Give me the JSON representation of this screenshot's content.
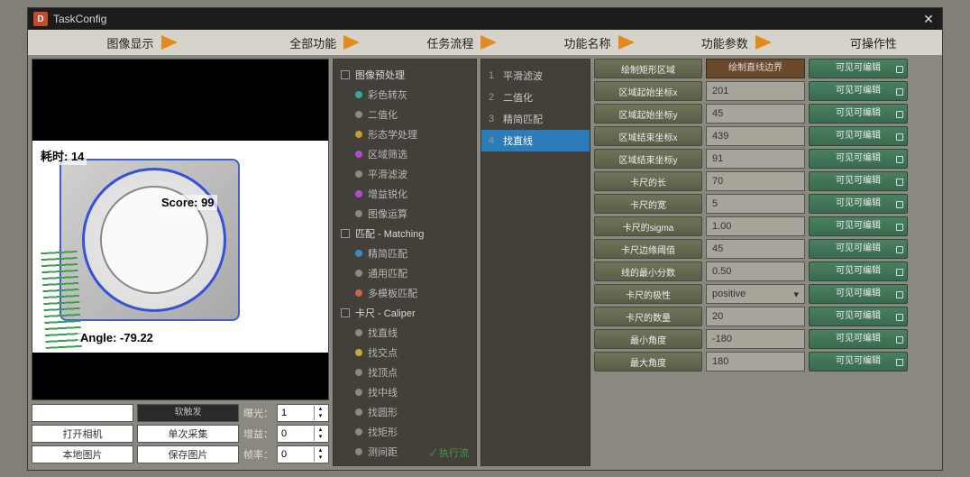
{
  "window": {
    "title": "TaskConfig"
  },
  "headers": [
    "图像显示",
    "全部功能",
    "任务流程",
    "功能名称",
    "功能参数",
    "可操作性"
  ],
  "image": {
    "timing": "耗时: 14",
    "score": "Score: 99",
    "angle": "Angle: -79.22"
  },
  "imgctrl": {
    "row1": {
      "darklabel": "软触发",
      "label": "曝光：",
      "value": "1"
    },
    "row2": {
      "btn1": "打开相机",
      "btn2": "单次采集",
      "label": "增益：",
      "value": "0"
    },
    "row3": {
      "btn1": "本地图片",
      "btn2": "保存图片",
      "label": "帧率：",
      "value": "0"
    }
  },
  "funcs": {
    "cat1": "图像预处理",
    "items1": [
      {
        "label": "彩色转灰",
        "color": "#39a5a5"
      },
      {
        "label": "二值化",
        "color": "#888"
      },
      {
        "label": "形态学处理",
        "color": "#c79a3a"
      },
      {
        "label": "区域筛选",
        "color": "#b44ad0"
      },
      {
        "label": "平滑滤波",
        "color": "#888"
      },
      {
        "label": "增益锐化",
        "color": "#b44ad0"
      },
      {
        "label": "图像运算",
        "color": "#888"
      }
    ],
    "cat2": "匹配 - Matching",
    "items2": [
      {
        "label": "精简匹配",
        "color": "#3a8ac8"
      },
      {
        "label": "通用匹配",
        "color": "#888"
      },
      {
        "label": "多模板匹配",
        "color": "#c46a4a"
      }
    ],
    "cat3": "卡尺 - Caliper",
    "items3": [
      {
        "label": "找直线",
        "color": "#888"
      },
      {
        "label": "找交点",
        "color": "#c8a838"
      },
      {
        "label": "找顶点",
        "color": "#888"
      },
      {
        "label": "找中线",
        "color": "#888"
      },
      {
        "label": "找圆形",
        "color": "#888"
      },
      {
        "label": "找矩形",
        "color": "#888"
      },
      {
        "label": "测间距",
        "color": "#888"
      }
    ],
    "exec": "✓ 执行流"
  },
  "flow": [
    {
      "num": "1",
      "label": "平滑滤波"
    },
    {
      "num": "2",
      "label": "二值化"
    },
    {
      "num": "3",
      "label": "精简匹配"
    },
    {
      "num": "4",
      "label": "找直线",
      "sel": true
    }
  ],
  "names": [
    "绘制矩形区域",
    "区域起始坐标x",
    "区域起始坐标y",
    "区域结束坐标x",
    "区域结束坐标y",
    "卡尺的长",
    "卡尺的宽",
    "卡尺的sigma",
    "卡尺边缘阈值",
    "线的最小分数",
    "卡尺的极性",
    "卡尺的数量",
    "最小角度",
    "最大角度"
  ],
  "params": {
    "title": "绘制直线边界",
    "values": [
      "201",
      "45",
      "439",
      "91",
      "70",
      "5",
      "1.00",
      "45",
      "0.50",
      "positive",
      "20",
      "-180",
      "180"
    ]
  },
  "ops_label": "可见可编辑"
}
